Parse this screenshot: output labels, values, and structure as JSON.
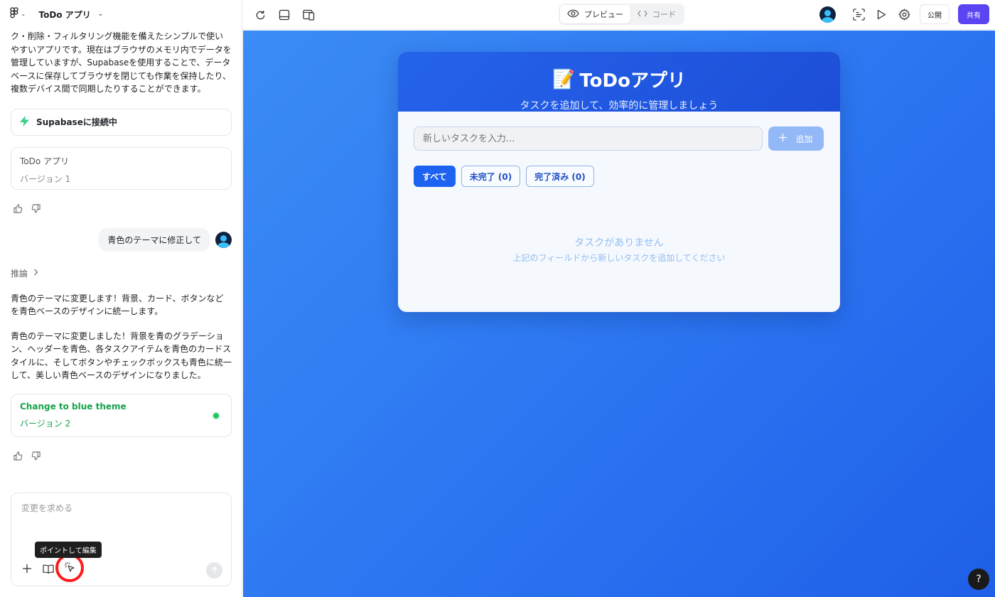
{
  "app": {
    "title": "ToDo アプリ"
  },
  "chat": {
    "intro_text": "ク・削除・フィルタリング機能を備えたシンプルで使いやすいアプリです。現在はブラウザのメモリ内でデータを管理していますが、Supabaseを使用することで、データベースに保存してブラウザを閉じても作業を保持したり、複数デバイス間で同期したりすることができます。",
    "supabase_status": "Supabaseに接続中",
    "version1": {
      "title": "ToDo アプリ",
      "label": "バージョン 1"
    },
    "user_message": "青色のテーマに修正して",
    "reasoning_label": "推論",
    "reply_p1": "青色のテーマに変更します！背景、カード、ボタンなどを青色ベースのデザインに統一します。",
    "reply_p2": "青色のテーマに変更しました！背景を青のグラデーション、ヘッダーを青色、各タスクアイテムを青色のカードスタイルに、そしてボタンやチェックボックスも青色に統一して、美しい青色ベースのデザインになりました。",
    "version2": {
      "title": "Change to blue theme",
      "label": "バージョン 2"
    }
  },
  "composer": {
    "placeholder": "変更を求める",
    "tooltip": "ポイントして編集"
  },
  "toolbar": {
    "preview_label": "プレビュー",
    "code_label": "コード",
    "publish_label": "公開",
    "share_label": "共有"
  },
  "todo": {
    "emoji": "📝",
    "title": "ToDoアプリ",
    "subtitle": "タスクを追加して、効率的に管理しましょう",
    "input_placeholder": "新しいタスクを入力...",
    "add_label": "追加",
    "filters": [
      "すべて",
      "未完了 (0)",
      "完了済み (0)"
    ],
    "empty_title": "タスクがありません",
    "empty_sub": "上記のフィールドから新しいタスクを追加してください"
  },
  "help_label": "?",
  "colors": {
    "accent": "#5b44f2",
    "preview_bg": "#2d77f2",
    "header_blue": "#2563eb",
    "success": "#16a34a",
    "highlight": "#ff1a1a"
  }
}
